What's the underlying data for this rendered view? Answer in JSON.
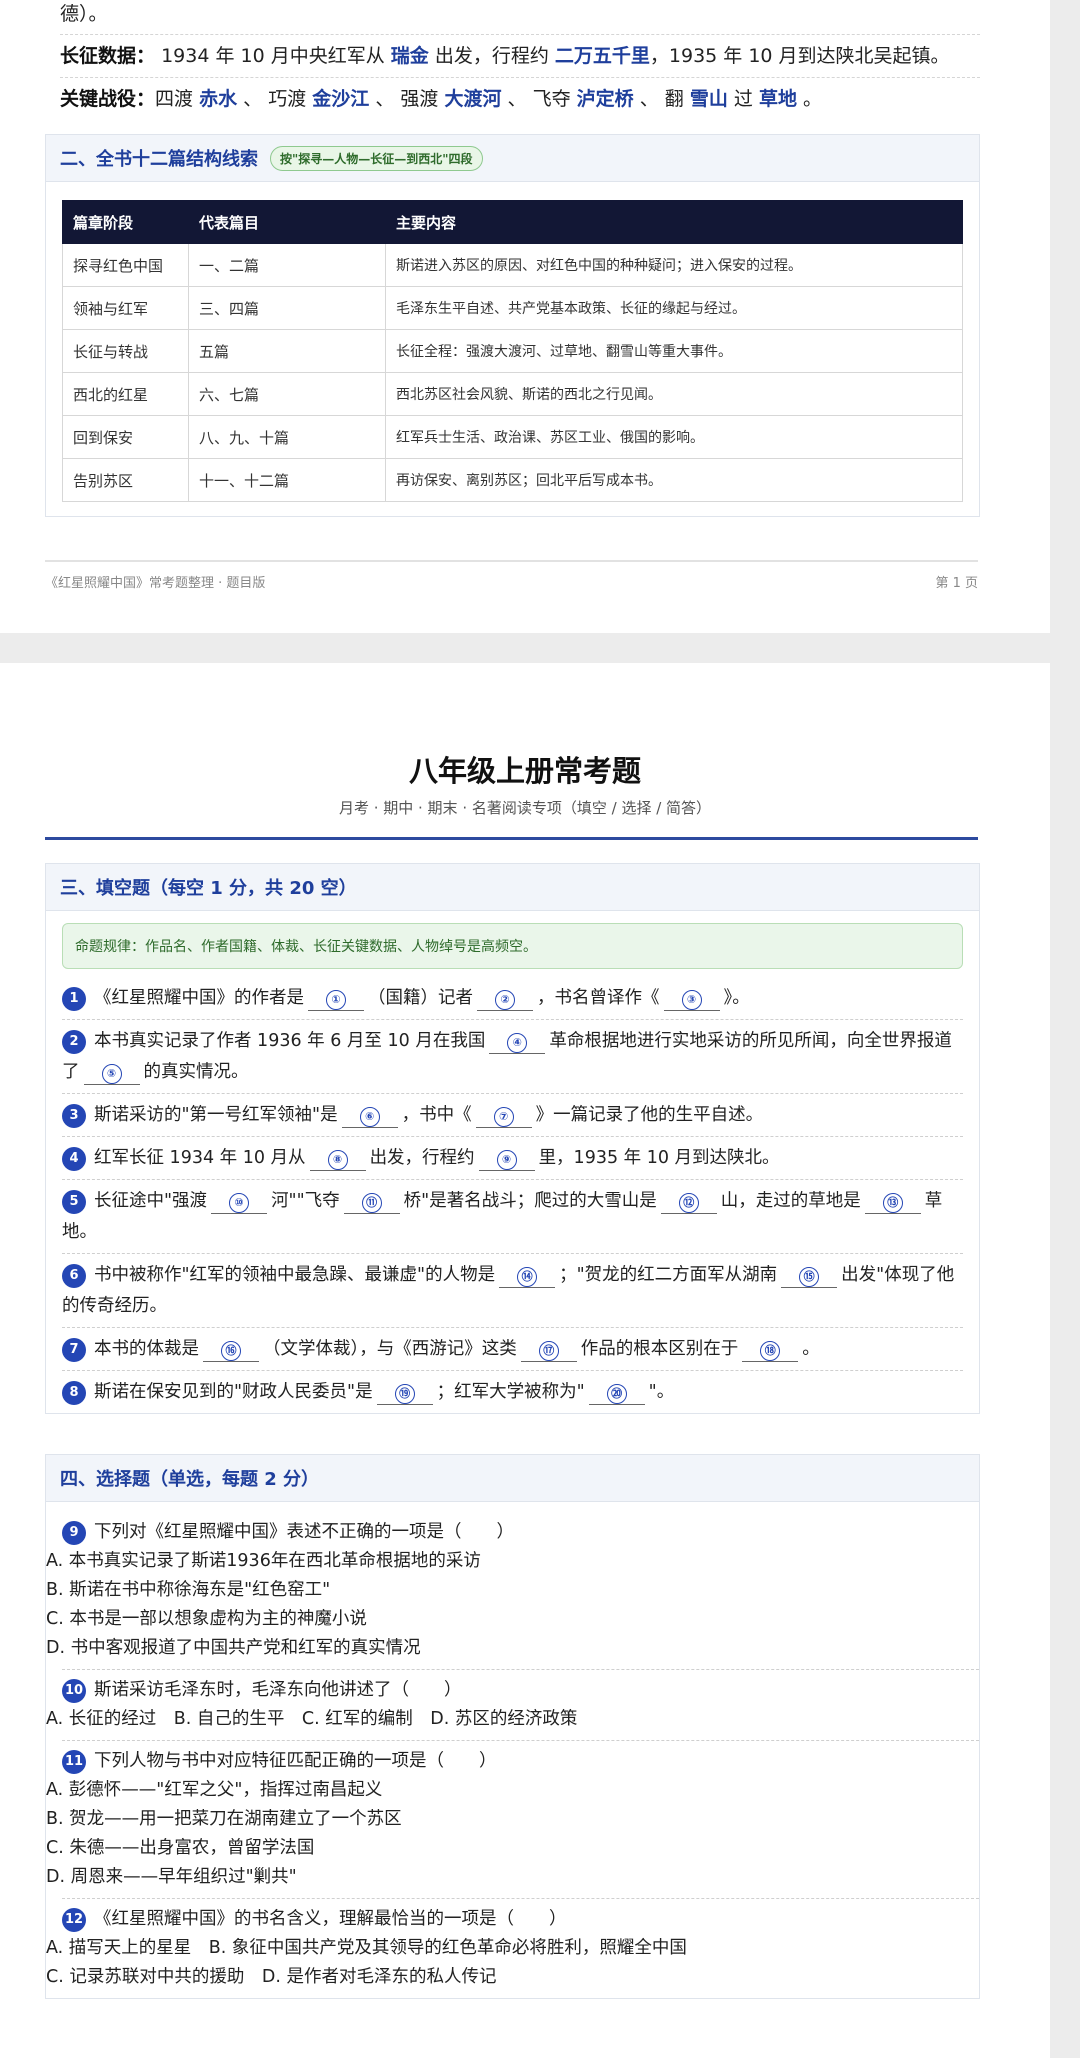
{
  "page1": {
    "cont_text": "德）。",
    "long_march": {
      "label": "长征数据：",
      "t1": "1934 年 10 月中央红军从",
      "place": "瑞金",
      "t2": "出发，行程约",
      "distance": "二万五千里",
      "t3": "，1935 年 10 月到达陕北吴起镇。"
    },
    "battles": {
      "label": "关键战役：",
      "items": [
        {
          "verb": "四渡",
          "name": "赤水",
          "sep": "、"
        },
        {
          "verb": "巧渡",
          "name": "金沙江",
          "sep": "、"
        },
        {
          "verb": "强渡",
          "name": "大渡河",
          "sep": "、"
        },
        {
          "verb": "飞夺",
          "name": "泸定桥",
          "sep": "、"
        },
        {
          "verb": "翻",
          "name": "雪山",
          "sep": ""
        }
      ],
      "last_verb": "过",
      "last_name": "草地",
      "end": "。"
    },
    "section2": {
      "title": "二、全书十二篇结构线索",
      "badge": "按\"探寻—人物—长征—到西北\"四段",
      "headers": [
        "篇章阶段",
        "代表篇目",
        "主要内容"
      ],
      "rows": [
        [
          "探寻红色中国",
          "一、二篇",
          "斯诺进入苏区的原因、对红色中国的种种疑问；进入保安的过程。"
        ],
        [
          "领袖与红军",
          "三、四篇",
          "毛泽东生平自述、共产党基本政策、长征的缘起与经过。"
        ],
        [
          "长征与转战",
          "五篇",
          "长征全程：强渡大渡河、过草地、翻雪山等重大事件。"
        ],
        [
          "西北的红星",
          "六、七篇",
          "西北苏区社会风貌、斯诺的西北之行见闻。"
        ],
        [
          "回到保安",
          "八、九、十篇",
          "红军兵士生活、政治课、苏区工业、俄国的影响。"
        ],
        [
          "告别苏区",
          "十一、十二篇",
          "再访保安、离别苏区；回北平后写成本书。"
        ]
      ]
    },
    "footer": {
      "left": "《红星照耀中国》常考题整理 · 题目版",
      "right": "第 1 页"
    }
  },
  "page2": {
    "title": "八年级上册常考题",
    "subtitle": "月考 · 期中 · 期末 · 名著阅读专项（填空 / 选择 / 简答）",
    "section3": {
      "title": "三、填空题（每空 1 分，共 20 空）",
      "hint": "命题规律：作品名、作者国籍、体裁、长征关键数据、人物绰号是高频空。",
      "questions": [
        {
          "n": "1",
          "parts": [
            "《红星照耀中国》的作者是",
            "①",
            "（国籍）记者",
            "②",
            "，书名曾译作《",
            "③",
            "》。"
          ]
        },
        {
          "n": "2",
          "parts": [
            "本书真实记录了作者 1936 年 6 月至 10 月在我国",
            "④",
            "革命根据地进行实地采访的所见所闻，向全世界报道了",
            "⑤",
            "的真实情况。"
          ]
        },
        {
          "n": "3",
          "parts": [
            "斯诺采访的\"第一号红军领袖\"是",
            "⑥",
            "，书中《",
            "⑦",
            "》一篇记录了他的生平自述。"
          ]
        },
        {
          "n": "4",
          "parts": [
            "红军长征 1934 年 10 月从",
            "⑧",
            "出发，行程约",
            "⑨",
            "里，1935 年 10 月到达陕北。"
          ]
        },
        {
          "n": "5",
          "parts": [
            "长征途中\"强渡",
            "⑩",
            "河\"\"飞夺",
            "⑪",
            "桥\"是著名战斗；爬过的大雪山是",
            "⑫",
            "山，走过的草地是",
            "⑬",
            "草地。"
          ]
        },
        {
          "n": "6",
          "parts": [
            "书中被称作\"红军的领袖中最急躁、最谦虚\"的人物是",
            "⑭",
            "；\"贺龙的红二方面军从湖南",
            "⑮",
            "出发\"体现了他的传奇经历。"
          ]
        },
        {
          "n": "7",
          "parts": [
            "本书的体裁是",
            "⑯",
            "（文学体裁），与《西游记》这类",
            "⑰",
            "作品的根本区别在于",
            "⑱",
            "。"
          ]
        },
        {
          "n": "8",
          "parts": [
            "斯诺在保安见到的\"财政人民委员\"是",
            "⑲",
            "；红军大学被称为\"",
            "⑳",
            "\"。"
          ]
        }
      ]
    },
    "section4": {
      "title": "四、选择题（单选，每题 2 分）",
      "questions": [
        {
          "n": "9",
          "stem": "下列对《红星照耀中国》表述不正确的一项是（　　）",
          "lines": [
            "A. 本书真实记录了斯诺1936年在西北革命根据地的采访",
            "B. 斯诺在书中称徐海东是\"红色窑工\"",
            "C. 本书是一部以想象虚构为主的神魔小说",
            "D. 书中客观报道了中国共产党和红军的真实情况"
          ]
        },
        {
          "n": "10",
          "stem": "斯诺采访毛泽东时，毛泽东向他讲述了（　　）",
          "lines": [
            "A. 长征的经过　B. 自己的生平　C. 红军的编制　D. 苏区的经济政策"
          ]
        },
        {
          "n": "11",
          "stem": "下列人物与书中对应特征匹配正确的一项是（　　）",
          "lines": [
            "A. 彭德怀——\"红军之父\"，指挥过南昌起义",
            "B. 贺龙——用一把菜刀在湖南建立了一个苏区",
            "C. 朱德——出身富农，曾留学法国",
            "D. 周恩来——早年组织过\"剿共\""
          ]
        },
        {
          "n": "12",
          "stem": "《红星照耀中国》的书名含义，理解最恰当的一项是（　　）",
          "lines": [
            "A. 描写天上的星星　B. 象征中国共产党及其领导的红色革命必将胜利，照耀全中国",
            "C. 记录苏联对中共的援助　D. 是作者对毛泽东的私人传记"
          ]
        }
      ]
    }
  }
}
